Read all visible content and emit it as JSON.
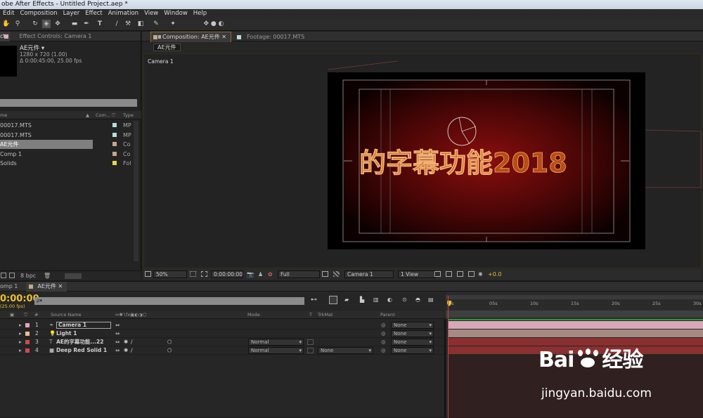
{
  "window": {
    "title": "obe After Effects - Untitled Project.aep *"
  },
  "menu": [
    "Edit",
    "Composition",
    "Layer",
    "Effect",
    "Animation",
    "View",
    "Window",
    "Help"
  ],
  "project": {
    "tab_left": "ct",
    "tab_effect": "Effect Controls: Camera 1",
    "comp_name": "AE元件 ▾",
    "comp_size": "1280 x 720 (1.00)",
    "comp_duration": "Δ 0:00:45:00, 25.00 fps",
    "col_name": "me",
    "col_comment": "Com...",
    "col_type": "Type",
    "items": [
      {
        "name": "00017.MTS",
        "type": "MP",
        "color": "#b6dcdc"
      },
      {
        "name": "00017.MTS",
        "type": "MP",
        "color": "#b6dcdc"
      },
      {
        "name": "AE元件",
        "type": "Co",
        "color": "#c4a88a",
        "selected": true
      },
      {
        "name": "Comp 1",
        "type": "Co",
        "color": "#c4a88a"
      },
      {
        "name": "Solids",
        "type": "Fol",
        "color": "#e8d84a"
      }
    ],
    "bpc": "8 bpc"
  },
  "composition": {
    "tab_comp": "Composition: AE元件",
    "tab_footage": "Footage: 00017.MTS",
    "breadcrumb": "AE元件",
    "camera_label": "Camera 1",
    "canvas_text": "的字幕功能2018",
    "zoom": "50%",
    "timecode": "0:00:00:00",
    "resolution": "Full",
    "view_camera": "Camera 1",
    "views": "1 View",
    "exposure": "+0.0"
  },
  "timeline": {
    "tab_comp1": "omp 1",
    "tab_ae": "AE元件",
    "timecode": "0:00:00",
    "fps": "(25.00 fps)",
    "search_placeholder": "ρ▾",
    "columns": {
      "num": "#",
      "source": "Source Name",
      "mode": "Mode",
      "t": "T",
      "trkmat": "TrkMat",
      "parent": "Parent"
    },
    "layers": [
      {
        "num": "1",
        "name": "Camera 1",
        "color": "#e0a8b8",
        "mode": "",
        "trkmat": "",
        "parent": "None"
      },
      {
        "num": "2",
        "name": "Light 1",
        "color": "#e8c090",
        "mode": "",
        "trkmat": "",
        "parent": "None"
      },
      {
        "num": "3",
        "name": "AE的字幕功能...22",
        "color": "#d04a4a",
        "mode": "Normal",
        "trkmat": "",
        "parent": "None"
      },
      {
        "num": "4",
        "name": "Deep Red Solid 1",
        "color": "#d04a4a",
        "mode": "Normal",
        "trkmat": "None",
        "parent": "None"
      }
    ],
    "ruler": [
      "0s",
      "05s",
      "10s",
      "15s",
      "20s",
      "25s",
      "30s"
    ]
  },
  "watermark": {
    "brand_left": "Bai",
    "brand_right": "经验",
    "url": "jingyan.baidu.com"
  }
}
